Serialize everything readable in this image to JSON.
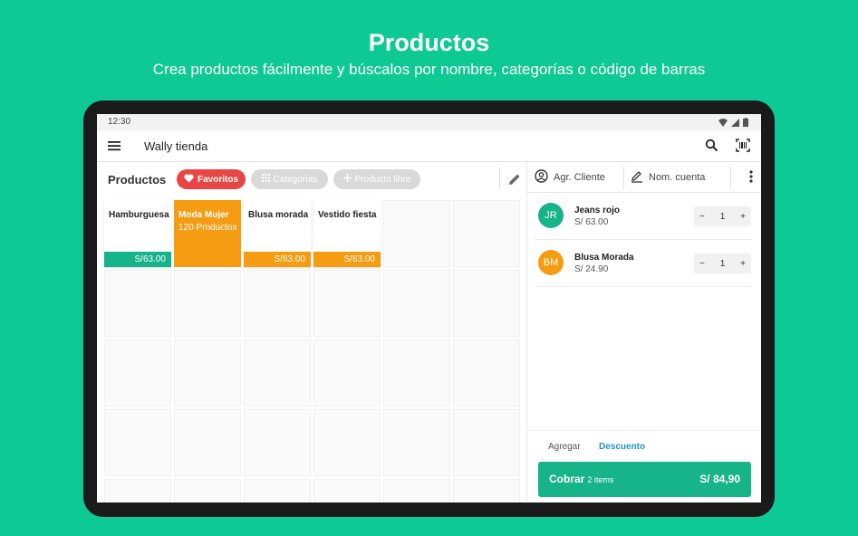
{
  "hero": {
    "title": "Productos",
    "subtitle": "Crea productos fácilmente y búscalos por nombre, categorías o código de barras"
  },
  "status": {
    "time": "12:30"
  },
  "appbar": {
    "title": "Wally tienda"
  },
  "products": {
    "title": "Productos",
    "chips": {
      "favorites": "Favoritos",
      "categories": "Categorías",
      "free_product": "Producto libre"
    },
    "tiles": [
      {
        "name": "Hamburguesa",
        "price": "S/63.00",
        "color": "#17b389"
      },
      {
        "name": "Moda Mujer",
        "count": "120 Productos",
        "type": "category",
        "color": "#f59c12"
      },
      {
        "name": "Blusa morada",
        "price": "S/63.00",
        "color": "#f59c12"
      },
      {
        "name": "Vestido fiesta",
        "price": "S/63.00",
        "color": "#f59c12"
      }
    ]
  },
  "cart": {
    "add_client": "Agr. Cliente",
    "name_account": "Nom. cuenta",
    "items": [
      {
        "initials": "JR",
        "name": "Jeans rojo",
        "price": "S/ 63.00",
        "qty": "1",
        "color": "#17b389"
      },
      {
        "initials": "BM",
        "name": "Blusa Morada",
        "price": "S/ 24.90",
        "qty": "1",
        "color": "#f59c12"
      }
    ],
    "add_label": "Agregar",
    "discount_label": "Descuento",
    "pay_label": "Cobrar",
    "pay_items": "2 items",
    "pay_total": "S/ 84,90"
  },
  "colors": {
    "brand": "#0dc993",
    "accent": "#17b389",
    "orange": "#f59c12",
    "favorite": "#e84545",
    "link": "#1b95c9"
  }
}
